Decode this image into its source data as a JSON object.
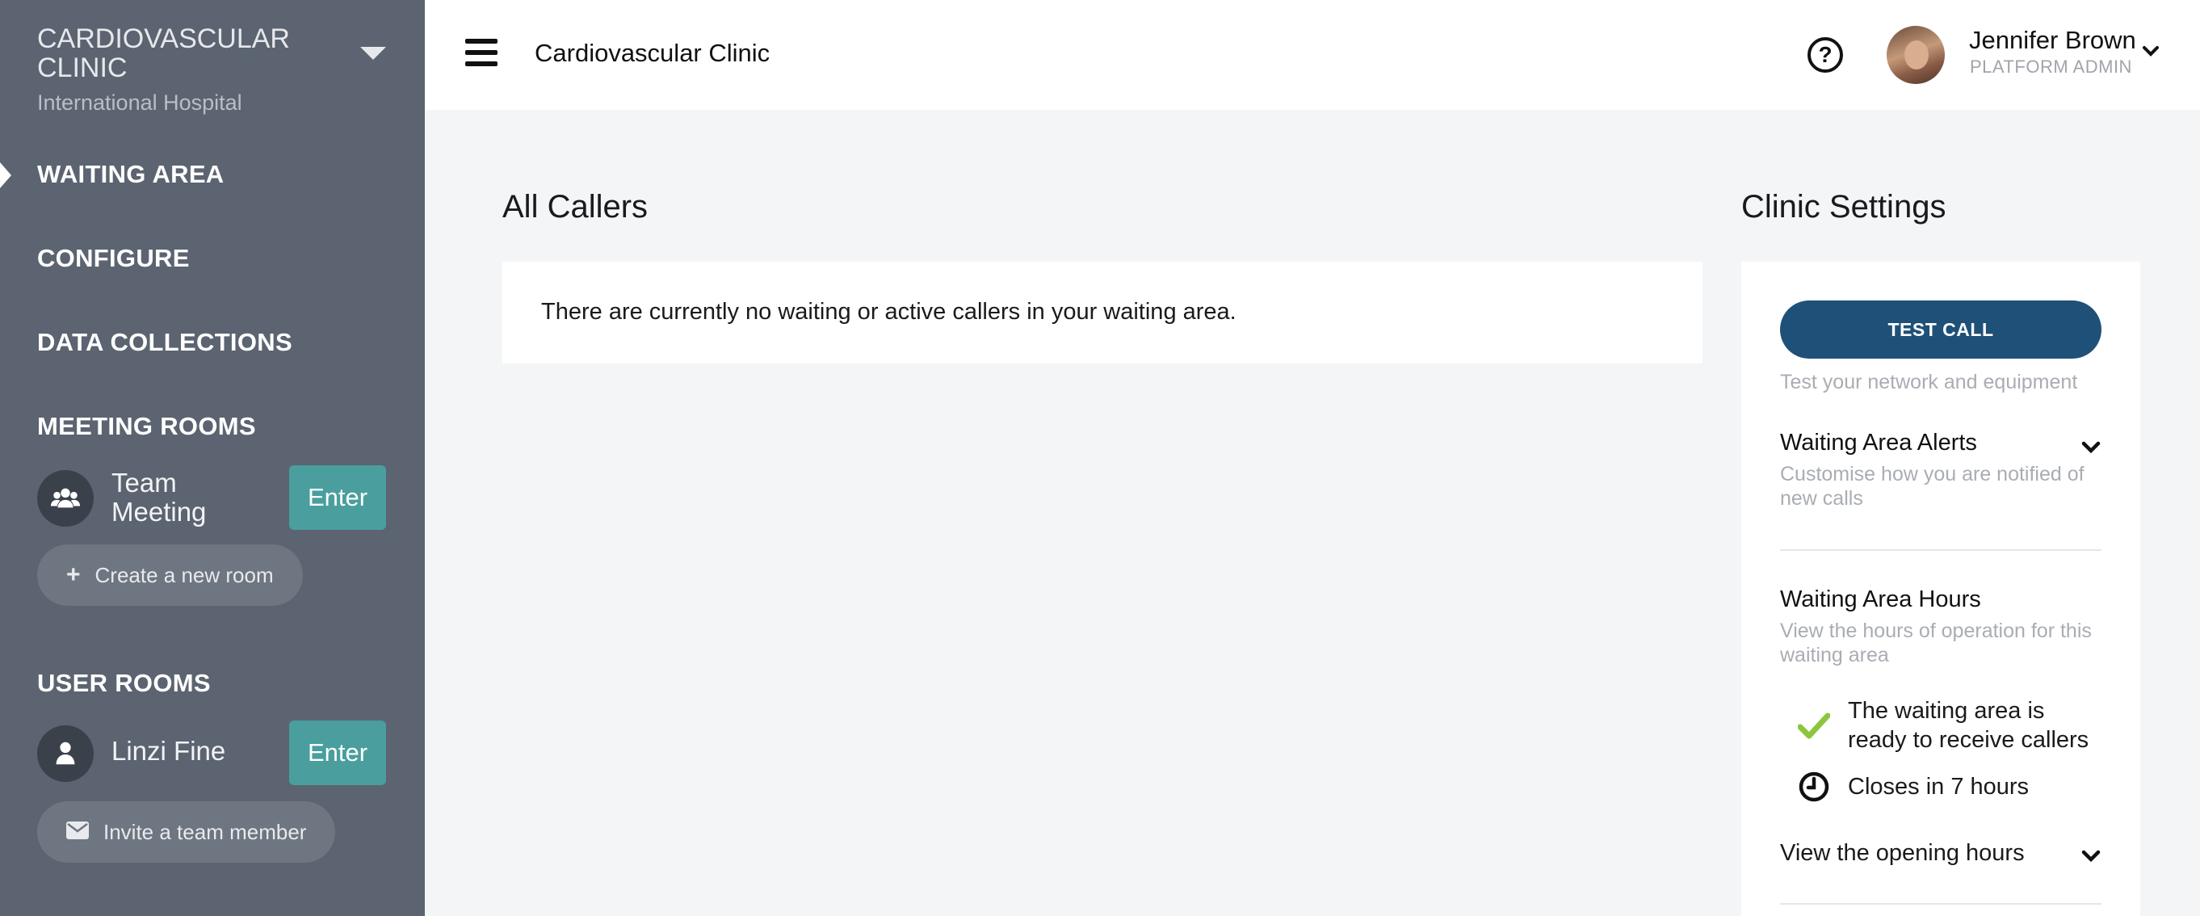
{
  "sidebar": {
    "clinic_name": "CARDIOVASCULAR CLINIC",
    "clinic_org": "International Hospital",
    "nav": {
      "waiting_area": "WAITING AREA",
      "configure": "CONFIGURE",
      "data_collections": "DATA COLLECTIONS",
      "meeting_rooms": "MEETING ROOMS",
      "user_rooms": "USER ROOMS"
    },
    "meeting_room": {
      "name": "Team Meeting",
      "enter_label": "Enter"
    },
    "create_room_label": "Create a new room",
    "user_room": {
      "name": "Linzi Fine",
      "enter_label": "Enter"
    },
    "invite_label": "Invite a team member",
    "colors": {
      "background": "#5b6470",
      "enter_button": "#4a9e9e"
    }
  },
  "header": {
    "title": "Cardiovascular Clinic",
    "user_name": "Jennifer Brown",
    "user_role": "PLATFORM ADMIN",
    "help_glyph": "?"
  },
  "callers": {
    "title": "All Callers",
    "empty_message": "There are currently no waiting or active callers in your waiting area."
  },
  "settings": {
    "title": "Clinic Settings",
    "test_call_label": "TEST CALL",
    "test_call_caption": "Test your network and equipment",
    "alerts_heading": "Waiting Area Alerts",
    "alerts_desc": "Customise how you are notified of new calls",
    "hours_heading": "Waiting Area Hours",
    "hours_desc": "View the hours of operation for this waiting area",
    "status_ready": "The waiting area is ready to receive callers",
    "status_closes": "Closes in 7 hours",
    "view_hours_label": "View the opening hours",
    "colors": {
      "test_call": "#1f5078",
      "ready_check": "#8cc63f"
    }
  }
}
